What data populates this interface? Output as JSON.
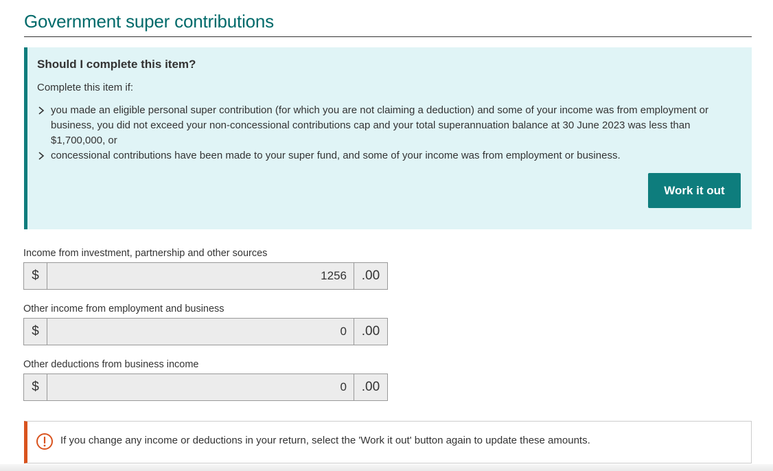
{
  "page": {
    "title": "Government super contributions"
  },
  "info": {
    "heading": "Should I complete this item?",
    "intro": "Complete this item if:",
    "items": [
      "you made an eligible personal super contribution (for which you are not claiming a deduction) and some of your income was from employment or business, you did not exceed your non-concessional contributions cap and your total superannuation balance at 30 June 2023 was less than $1,700,000, or",
      "concessional contributions have been made to your super fund, and some of your income was from employment or business."
    ],
    "button_label": "Work it out"
  },
  "fields": [
    {
      "label": "Income from investment, partnership and other sources",
      "currency": "$",
      "value": "1256",
      "cents": ".00"
    },
    {
      "label": "Other income from employment and business",
      "currency": "$",
      "value": "0",
      "cents": ".00"
    },
    {
      "label": "Other deductions from business income",
      "currency": "$",
      "value": "0",
      "cents": ".00"
    }
  ],
  "alert": {
    "icon": "exclamation-circle-icon",
    "text": "If you change any income or deductions in your return, select the 'Work it out' button again to update these amounts."
  },
  "colors": {
    "accent": "#0e7d7d",
    "title": "#006a6a",
    "info_bg": "#e0f4f6",
    "alert_border": "#d9531e"
  }
}
